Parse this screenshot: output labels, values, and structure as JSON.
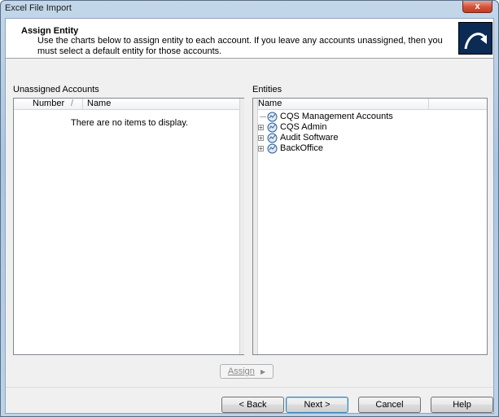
{
  "window": {
    "title": "Excel File Import",
    "close_glyph": "x"
  },
  "header": {
    "title": "Assign Entity",
    "description": "Use the charts below to assign entity to each account. If you leave any accounts unassigned, then you must select a default entity for those accounts.",
    "icon": "wizard-arrow-icon"
  },
  "unassigned": {
    "label": "Unassigned Accounts",
    "columns": [
      "Number",
      "Name"
    ],
    "sort_glyph": "/",
    "empty_message": "There are no items to display."
  },
  "entities": {
    "label": "Entities",
    "column": "Name",
    "items": [
      {
        "label": "CQS Management Accounts",
        "expandable": false
      },
      {
        "label": "CQS Admin",
        "expandable": true
      },
      {
        "label": "Audit Software",
        "expandable": true
      },
      {
        "label": "BackOffice",
        "expandable": true
      }
    ],
    "expand_glyph": "+"
  },
  "assign_button": {
    "label": "Assign",
    "arrow": "▶",
    "enabled": false
  },
  "footer": {
    "back": "< Back",
    "next": "Next >",
    "cancel": "Cancel",
    "help": "Help"
  },
  "colors": {
    "header_icon_bg": "#0b2b55",
    "close_button": "#c9452b",
    "default_button_border": "#3c7fb1"
  }
}
